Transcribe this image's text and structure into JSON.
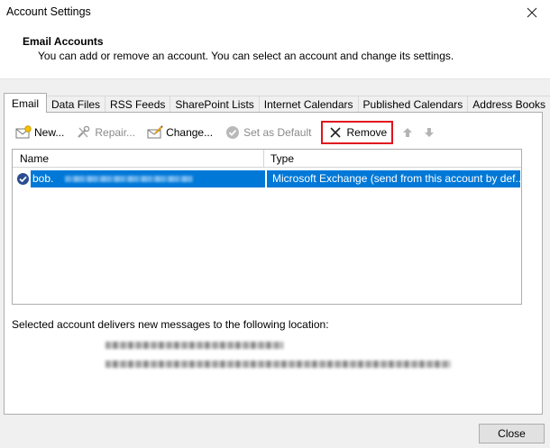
{
  "window": {
    "title": "Account Settings"
  },
  "header": {
    "title": "Email Accounts",
    "description": "You can add or remove an account. You can select an account and change its settings."
  },
  "tabs": [
    {
      "label": "Email",
      "active": true
    },
    {
      "label": "Data Files"
    },
    {
      "label": "RSS Feeds"
    },
    {
      "label": "SharePoint Lists"
    },
    {
      "label": "Internet Calendars"
    },
    {
      "label": "Published Calendars"
    },
    {
      "label": "Address Books"
    }
  ],
  "toolbar": {
    "new_label": "New...",
    "repair_label": "Repair...",
    "change_label": "Change...",
    "set_default_label": "Set as Default",
    "remove_label": "Remove"
  },
  "accounts": {
    "columns": {
      "name": "Name",
      "type": "Type"
    },
    "rows": [
      {
        "name": "bob.",
        "type": "Microsoft Exchange (send from this account by def..."
      }
    ]
  },
  "delivery": {
    "label": "Selected account delivers new messages to the following location:"
  },
  "footer": {
    "close_label": "Close"
  },
  "colors": {
    "selection": "#0078d7",
    "highlight_box": "#e0141e"
  }
}
